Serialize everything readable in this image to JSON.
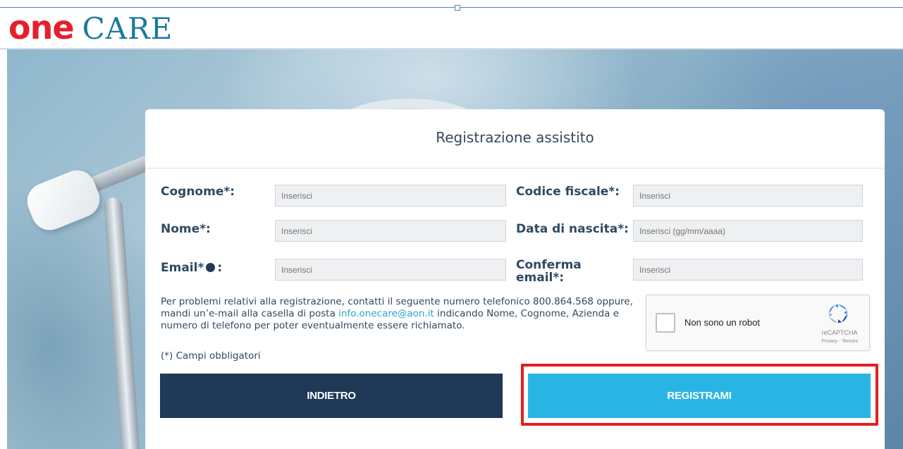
{
  "header": {
    "logo_one": "one",
    "logo_care": "CARE"
  },
  "form": {
    "title": "Registrazione assistito",
    "fields": {
      "cognome": {
        "label": "Cognome*:",
        "placeholder": "Inserisci"
      },
      "codice_fiscale": {
        "label": "Codice fiscale*:",
        "placeholder": "Inserisci"
      },
      "nome": {
        "label": "Nome*:",
        "placeholder": "Inserisci"
      },
      "data_nascita": {
        "label": "Data di nascita*:",
        "placeholder": "Inserisci (gg/mm/aaaa)"
      },
      "email": {
        "label": "Email*",
        "label_suffix": ":",
        "placeholder": "Inserisci"
      },
      "conferma_email": {
        "label_line1": "Conferma",
        "label_line2": "email*:",
        "placeholder": "Inserisci"
      }
    },
    "info": {
      "text_before_link": "Per problemi relativi alla registrazione, contatti il seguente numero telefonico 800.864.568 oppure, mandi un’e-mail alla casella di posta ",
      "link": "info.onecare@aon.it",
      "text_after_link": " indicando Nome, Cognome, Azienda e numero di telefono per poter eventualmente essere richiamato."
    },
    "required_note": "(*) Campi obbligatori",
    "recaptcha": {
      "label": "Non sono un robot",
      "brand": "reCAPTCHA",
      "terms": "Privacy - Termini"
    },
    "buttons": {
      "back": "INDIETRO",
      "register": "REGISTRAMI"
    }
  },
  "colors": {
    "brand_red": "#e5202e",
    "brand_teal": "#1a7a9c",
    "navy": "#1f3957",
    "cyan": "#29b5e3",
    "highlight": "#e0201f"
  }
}
